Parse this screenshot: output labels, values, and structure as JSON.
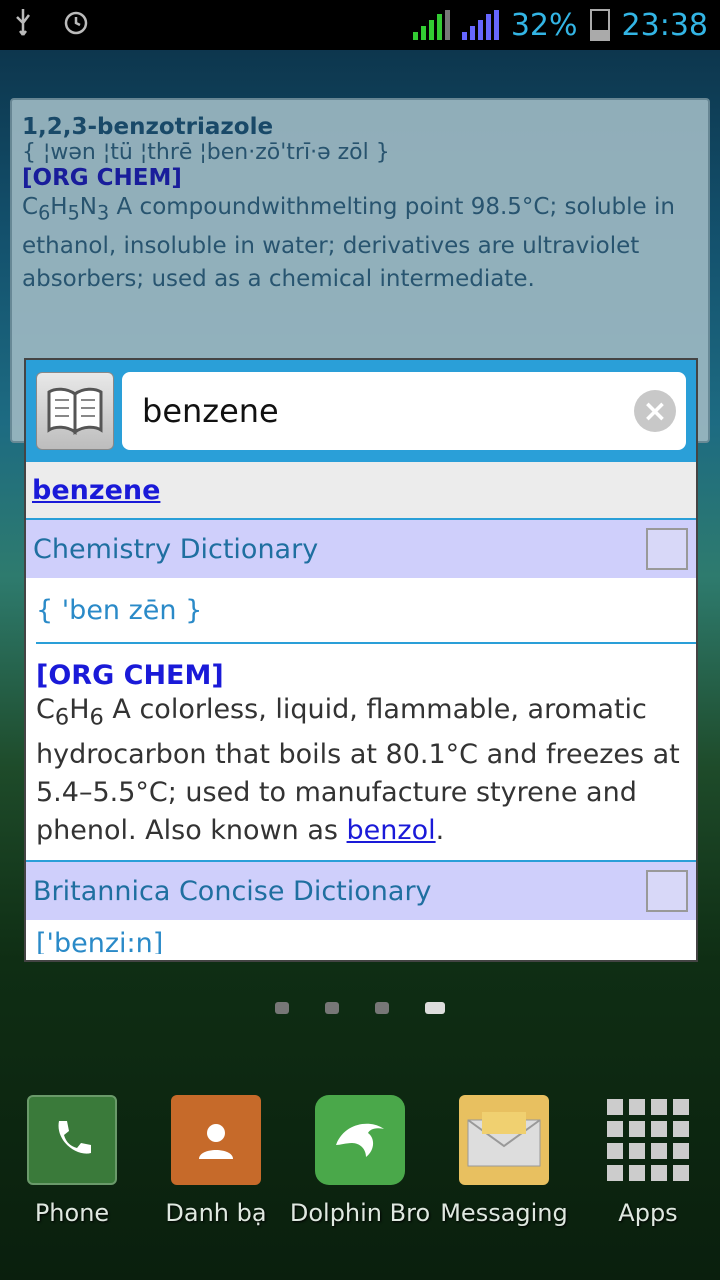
{
  "status_bar": {
    "battery": "32%",
    "time": "23:38",
    "icons": [
      "usb-icon",
      "alarm-icon",
      "signal-icon",
      "battery-icon"
    ]
  },
  "background_card": {
    "term": "1,2,3-benzotriazole",
    "pronunciation": "{ ¦wən ¦tü ¦thrē ¦ben·zō'trī·ə zōl }",
    "tag": "[ORG CHEM]",
    "formula_parts": [
      "C",
      "6",
      "H",
      "5",
      "N",
      "3"
    ],
    "definition": " A compoundwithmelting point 98.5°C; soluble in ethanol, insoluble in water; derivatives are ultraviolet absorbers; used as a chemical intermediate."
  },
  "popup": {
    "search_value": "benzene",
    "headword": "benzene",
    "dict1": {
      "name": "Chemistry Dictionary",
      "pronunciation": "{ 'ben zēn }",
      "tag": "[ORG CHEM]",
      "formula_parts": [
        "C",
        "6",
        "H",
        "6"
      ],
      "definition_before_link": " A colorless, liquid, flammable, aromatic hydrocarbon that boils at 80.1°C and freezes at 5.4–5.5°C; used to manufacture styrene and phenol. Also known as ",
      "link": "benzol",
      "definition_after_link": "."
    },
    "dict2": {
      "name": "Britannica Concise Dictionary",
      "pronunciation": "['benzi:n]"
    }
  },
  "home": {
    "pages": 4,
    "active_page": 4,
    "dock": [
      {
        "label": "Phone",
        "icon": "phone-icon"
      },
      {
        "label": "Danh bạ",
        "icon": "contacts-icon"
      },
      {
        "label": "Dolphin Bro",
        "icon": "dolphin-browser-icon"
      },
      {
        "label": "Messaging",
        "icon": "messaging-icon"
      },
      {
        "label": "Apps",
        "icon": "apps-grid-icon"
      }
    ]
  }
}
